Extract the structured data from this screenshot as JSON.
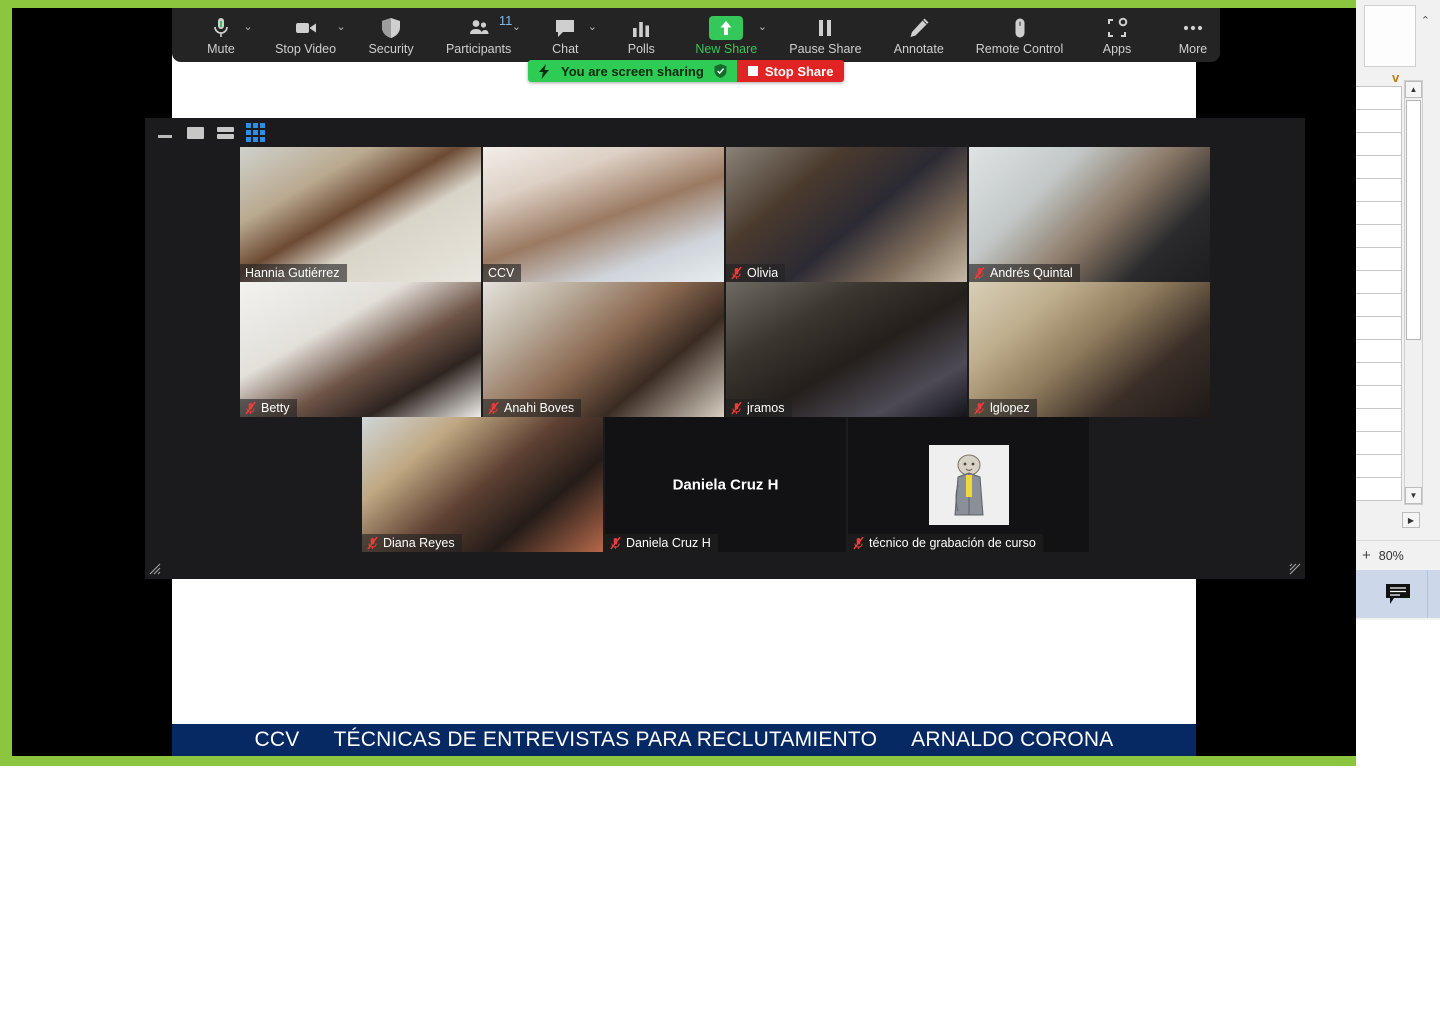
{
  "meeting_toolbar": {
    "items": [
      {
        "label": "Mute",
        "icon": "microphone-icon",
        "has_caret": true,
        "accent": false,
        "badge": null
      },
      {
        "label": "Stop Video",
        "icon": "video-camera-icon",
        "has_caret": true,
        "accent": false,
        "badge": null
      },
      {
        "label": "Security",
        "icon": "shield-icon",
        "has_caret": false,
        "accent": false,
        "badge": null
      },
      {
        "label": "Participants",
        "icon": "participants-icon",
        "has_caret": true,
        "accent": false,
        "badge": "11"
      },
      {
        "label": "Chat",
        "icon": "chat-bubble-icon",
        "has_caret": true,
        "accent": false,
        "badge": null
      },
      {
        "label": "Polls",
        "icon": "polls-bars-icon",
        "has_caret": false,
        "accent": false,
        "badge": null
      },
      {
        "label": "New Share",
        "icon": "share-up-arrow-icon",
        "has_caret": true,
        "accent": true,
        "badge": null
      },
      {
        "label": "Pause Share",
        "icon": "pause-icon",
        "has_caret": false,
        "accent": false,
        "badge": null
      },
      {
        "label": "Annotate",
        "icon": "pencil-icon",
        "has_caret": false,
        "accent": false,
        "badge": null
      },
      {
        "label": "Remote Control",
        "icon": "mouse-icon",
        "has_caret": false,
        "accent": false,
        "badge": null
      },
      {
        "label": "Apps",
        "icon": "apps-icon",
        "has_caret": false,
        "accent": false,
        "badge": null
      },
      {
        "label": "More",
        "icon": "ellipsis-icon",
        "has_caret": false,
        "accent": false,
        "badge": null
      }
    ]
  },
  "share_banner": {
    "status_text": "You are screen sharing",
    "stop_label": "Stop Share",
    "green": "#2ecc55",
    "red": "#e02424"
  },
  "gallery": {
    "view_buttons": [
      {
        "name": "minimize",
        "active": false
      },
      {
        "name": "active-speaker-view",
        "active": false
      },
      {
        "name": "speaker-view",
        "active": false
      },
      {
        "name": "gallery-view",
        "active": true
      }
    ],
    "active_speaker_color": "#d8e24a",
    "rows": [
      [
        {
          "name": "Hannia Gutiérrez",
          "muted": false,
          "video": true,
          "active": false,
          "cam": "woman-curly-hair-office"
        },
        {
          "name": "CCV",
          "muted": false,
          "video": true,
          "active": true,
          "cam": "man-glasses-mustache"
        },
        {
          "name": "Olivia",
          "muted": true,
          "video": true,
          "active": false,
          "cam": "woman-glasses-braid"
        },
        {
          "name": "Andrés Quintal",
          "muted": true,
          "video": true,
          "active": false,
          "cam": "man-glasses-lab"
        }
      ],
      [
        {
          "name": "Betty",
          "muted": true,
          "video": true,
          "active": false,
          "cam": "woman-dark-hair-white-wall"
        },
        {
          "name": "Anahi Boves",
          "muted": true,
          "video": true,
          "active": true,
          "cam": "woman-glasses-posters"
        },
        {
          "name": "jramos",
          "muted": true,
          "video": true,
          "active": false,
          "cam": "woman-dark-room"
        },
        {
          "name": "lglopez",
          "muted": true,
          "video": true,
          "active": false,
          "cam": "woman-glasses-corkboard"
        }
      ],
      [
        {
          "name": "Diana Reyes",
          "muted": true,
          "video": true,
          "active": false,
          "cam": "woman-long-hair-door"
        },
        {
          "name": "Daniela Cruz H",
          "muted": true,
          "video": false,
          "active": false,
          "cam": null
        },
        {
          "name": "técnico de grabación de curso",
          "muted": true,
          "video": false,
          "active": false,
          "cam": "lion-suit-avatar"
        }
      ]
    ]
  },
  "slide": {
    "title_parts": [
      "CCV",
      "TÉCNICAS DE ENTREVISTAS PARA RECLUTAMIENTO",
      "ARNALDO CORONA"
    ],
    "bar_color": "#062863"
  },
  "sidebar": {
    "formula_dropdown": "v",
    "zoom_level": "80%",
    "zoom_in_label": "+",
    "comment_icon": "comment-icon",
    "scroll_up": "▲",
    "scroll_down": "▼",
    "scroll_right": "▶",
    "collapse": "⌃"
  }
}
